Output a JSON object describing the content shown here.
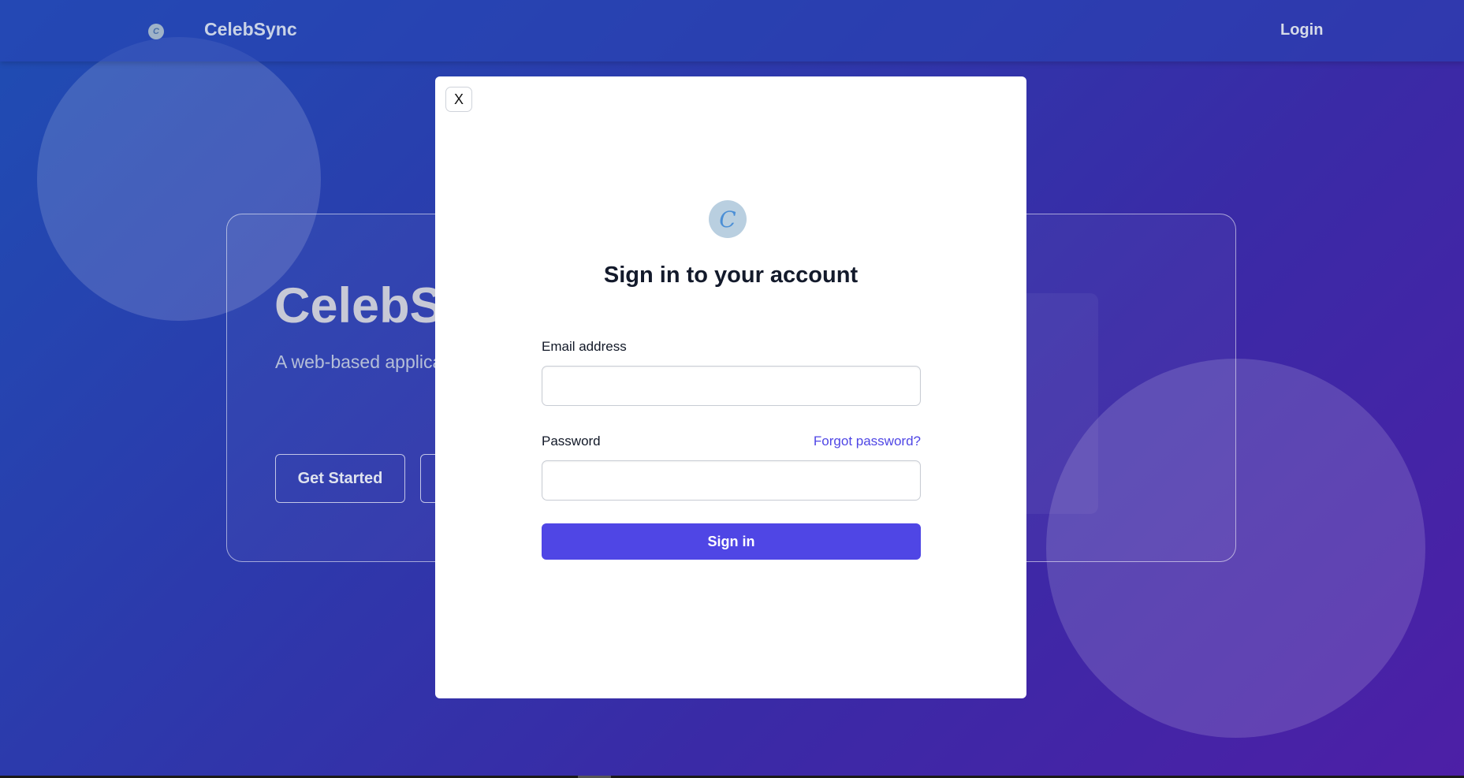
{
  "navbar": {
    "brand": "CelebSync",
    "login_label": "Login"
  },
  "hero": {
    "title": "CelebSync",
    "description": "A web-based application in managing the careers efficiently.",
    "get_started_label": "Get Started"
  },
  "modal": {
    "close_label": "X",
    "title": "Sign in to your account",
    "email_label": "Email address",
    "email_value": "",
    "password_label": "Password",
    "password_value": "",
    "forgot_label": "Forgot password?",
    "submit_label": "Sign in"
  },
  "colors": {
    "accent": "#4f46e5",
    "background_start": "#1f4db3",
    "background_end": "#4d1fa6"
  },
  "icons": {
    "brand_logo": "celebsync-logo-icon"
  }
}
